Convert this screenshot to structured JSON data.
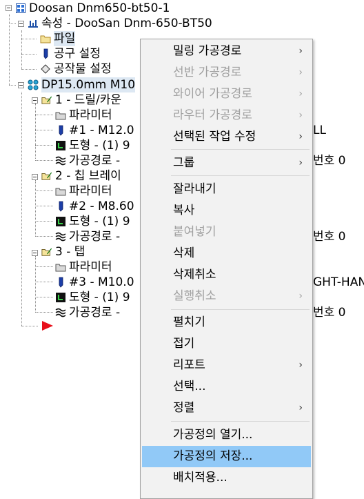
{
  "tree": {
    "root": "Doosan Dnm650-bt50-1",
    "properties": "속성 - DooSan Dnm-650-BT50",
    "file": "파일",
    "tool_settings": "공구 설정",
    "stock_settings": "공작물 설정",
    "operation_group": "DP15.0mm M10",
    "op1": {
      "label": "1 - 드릴/카운",
      "params": "파라미터",
      "tool": "#1 - M12.0",
      "tool_tail": "LL",
      "geometry": "도형 - (1) 9",
      "toolpath": "가공경로 -",
      "toolpath_tail": "번호 0"
    },
    "op2": {
      "label": "2 - 칩 브레이",
      "params": "파라미터",
      "tool": "#2 - M8.60",
      "geometry": "도형 - (1) 9",
      "toolpath": "가공경로 -",
      "toolpath_tail": "번호 0"
    },
    "op3": {
      "label": "3 - 탭",
      "params": "파라미터",
      "tool": "#3 - M10.0",
      "tool_tail": "GHT-HAN",
      "geometry": "도형 - (1) 9",
      "toolpath": "가공경로 -",
      "toolpath_tail": "번호 0"
    }
  },
  "context_menu": {
    "milling_toolpaths": "밀링 가공경로",
    "lathe_toolpaths": "선반 가공경로",
    "wire_toolpaths": "와이어 가공경로",
    "router_toolpaths": "라우터 가공경로",
    "edit_selected_operations": "선택된 작업 수정",
    "groups": "그룹",
    "cut": "잘라내기",
    "copy": "복사",
    "paste": "붙여넣기",
    "delete": "삭제",
    "undelete": "삭제취소",
    "undo": "실행취소",
    "expand": "펼치기",
    "collapse": "접기",
    "report": "리포트",
    "select": "선택...",
    "sort": "정렬",
    "open_operations": "가공정의 열기...",
    "save_operations": "가공정의 저장...",
    "batch": "배치적용...",
    "arrow_glyph": "›"
  },
  "colors": {
    "menu_highlight": "#91c9f7",
    "disabled_text": "#a0a0a0",
    "selected_node": "#dde8f3"
  }
}
